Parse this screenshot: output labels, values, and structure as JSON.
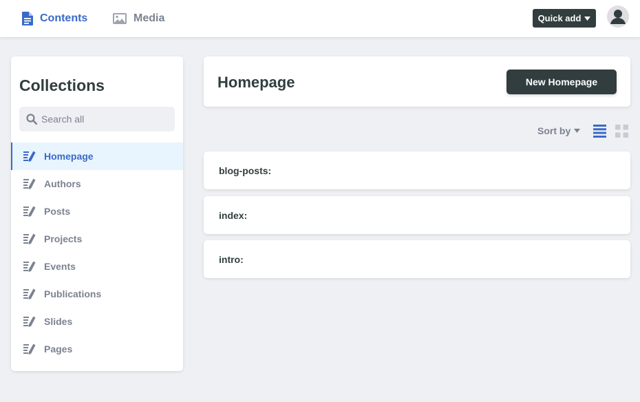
{
  "topbar": {
    "contents_label": "Contents",
    "media_label": "Media",
    "quick_add_label": "Quick add"
  },
  "sidebar": {
    "title": "Collections",
    "search_placeholder": "Search all",
    "items": [
      {
        "label": "Homepage",
        "active": true
      },
      {
        "label": "Authors"
      },
      {
        "label": "Posts"
      },
      {
        "label": "Projects"
      },
      {
        "label": "Events"
      },
      {
        "label": "Publications"
      },
      {
        "label": "Slides"
      },
      {
        "label": "Pages"
      }
    ]
  },
  "main": {
    "title": "Homepage",
    "new_button_label": "New Homepage",
    "sort_label": "Sort by",
    "entries": [
      {
        "label": "blog-posts:"
      },
      {
        "label": "index:"
      },
      {
        "label": "intro:"
      }
    ]
  },
  "colors": {
    "accent": "#3a69c7",
    "dark_button": "#313d3e",
    "muted_text": "#7b8290",
    "background": "#eff0f4",
    "active_row": "#e8f5fe"
  },
  "icons": {
    "contents": "document-icon",
    "media": "image-icon",
    "search": "search-icon",
    "collection": "write-icon",
    "list_view": "list-view-icon",
    "grid_view": "grid-view-icon",
    "avatar": "user-icon"
  }
}
